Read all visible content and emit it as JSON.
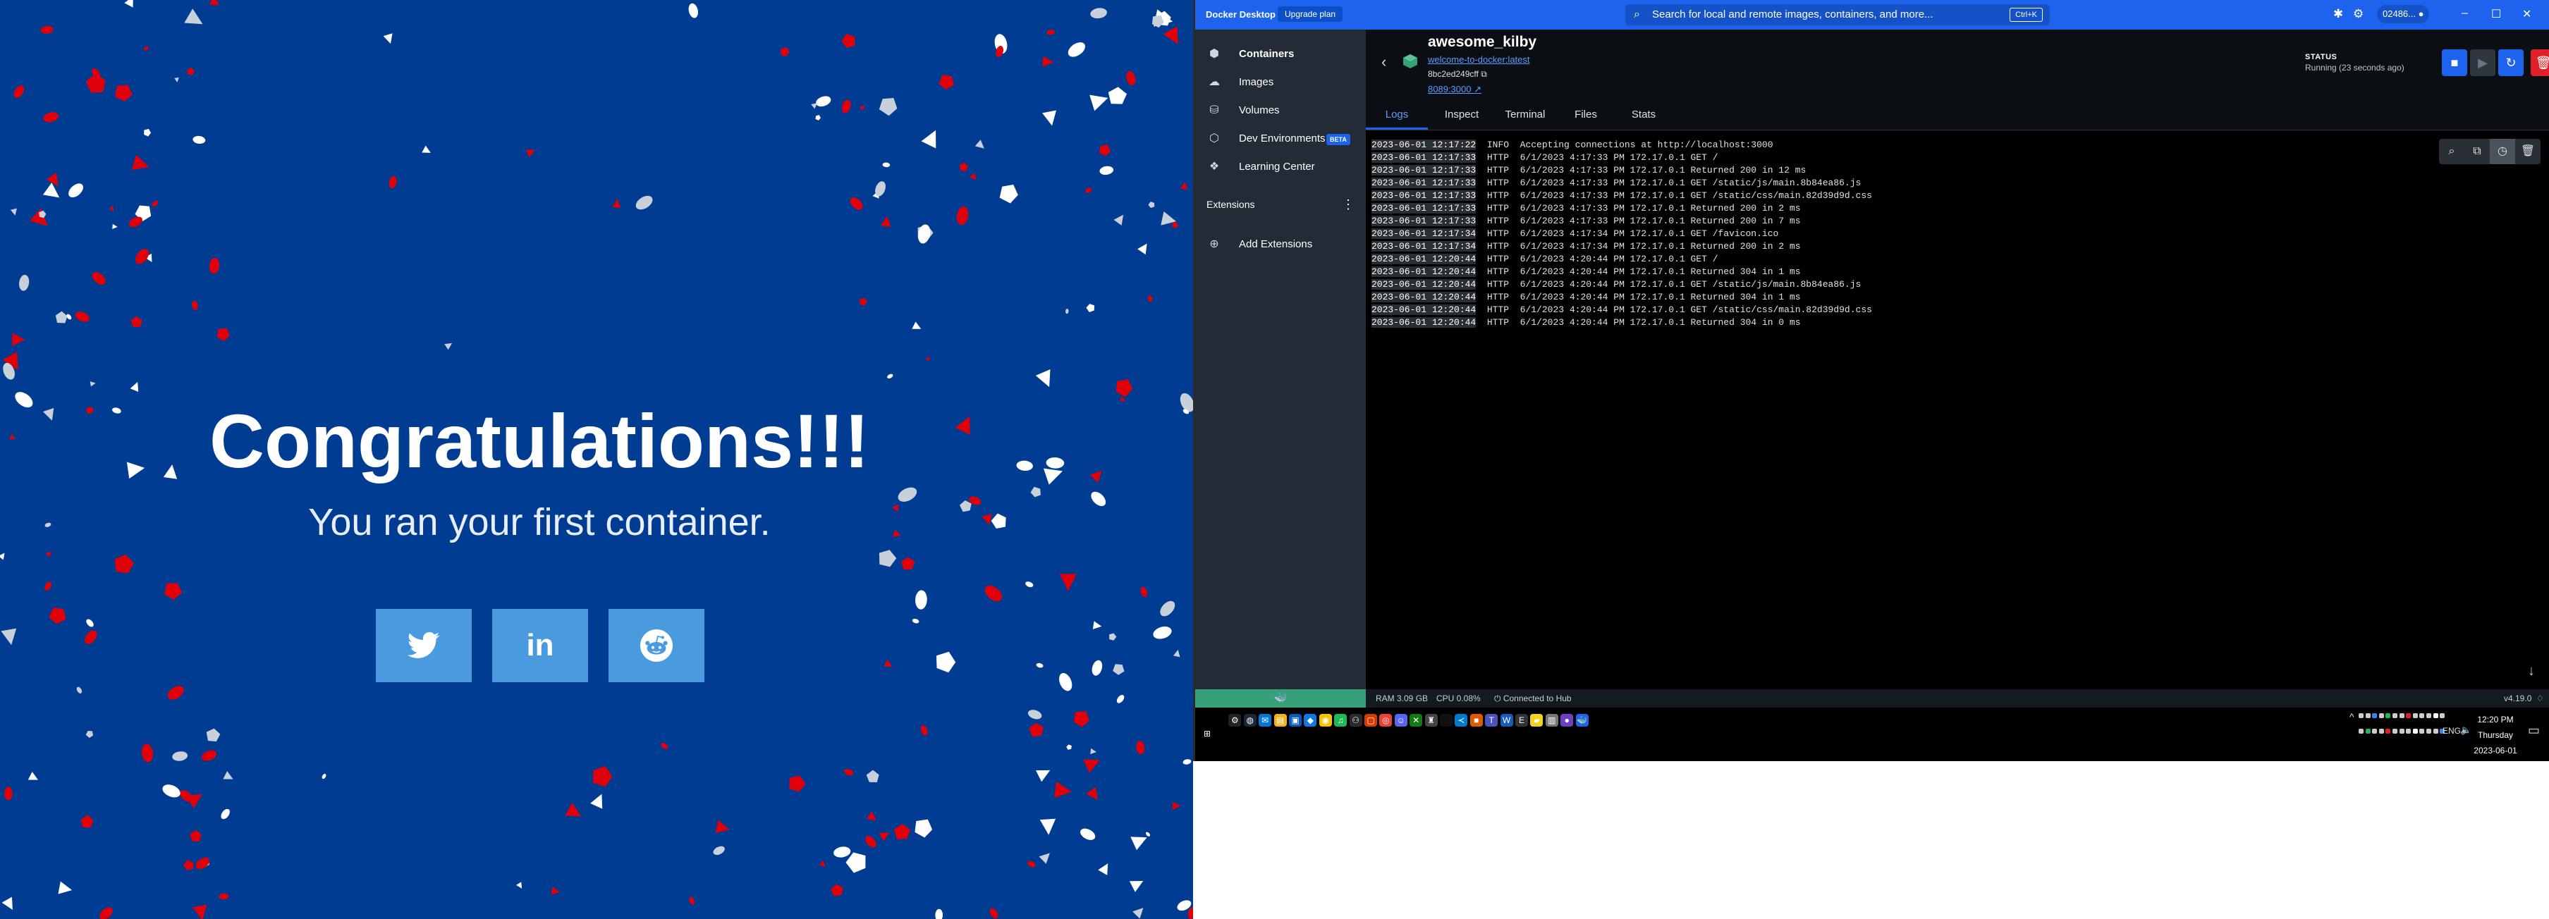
{
  "page": {
    "headline": "Congratulations!!!",
    "subtitle": "You ran your first container.",
    "share_buttons": [
      {
        "network": "twitter",
        "icon": "twitter-icon"
      },
      {
        "network": "linkedin",
        "icon": "linkedin-icon",
        "glyph": "in"
      },
      {
        "network": "reddit",
        "icon": "reddit-icon"
      }
    ],
    "colors": {
      "background": "#013c93",
      "button": "#4a9ae0",
      "confetti_red": "#e0000a",
      "confetti_white": "#ffffff"
    }
  },
  "docker": {
    "titlebar": {
      "app_name": "Docker Desktop",
      "upgrade_label": "Upgrade plan",
      "search_placeholder": "Search for local and remote images, containers, and more...",
      "search_shortcut": "Ctrl+K",
      "user": "02486...",
      "icons": [
        "bug-icon",
        "gear-icon",
        "account-icon",
        "minimize-icon",
        "maximize-icon",
        "close-icon"
      ]
    },
    "sidebar": {
      "items": [
        {
          "label": "Containers",
          "icon": "containers-icon",
          "active": true
        },
        {
          "label": "Images",
          "icon": "images-icon"
        },
        {
          "label": "Volumes",
          "icon": "volumes-icon"
        },
        {
          "label": "Dev Environments",
          "icon": "dev-environments-icon",
          "badge": "BETA"
        },
        {
          "label": "Learning Center",
          "icon": "learning-center-icon"
        }
      ],
      "extensions_label": "Extensions",
      "add_extensions_label": "Add Extensions"
    },
    "container": {
      "name": "awesome_kilby",
      "image": "welcome-to-docker:latest",
      "id": "8bc2ed249cff",
      "port": "8089:3000",
      "status_label": "STATUS",
      "status_value": "Running (23 seconds ago)"
    },
    "tabs": [
      "Logs",
      "Inspect",
      "Terminal",
      "Files",
      "Stats"
    ],
    "active_tab": "Logs",
    "logs": [
      {
        "ts": "2023-06-01 12:17:22",
        "level": "INFO",
        "msg": "Accepting connections at http://localhost:3000"
      },
      {
        "ts": "2023-06-01 12:17:33",
        "level": "HTTP",
        "msg": "6/1/2023 4:17:33 PM 172.17.0.1 GET /"
      },
      {
        "ts": "2023-06-01 12:17:33",
        "level": "HTTP",
        "msg": "6/1/2023 4:17:33 PM 172.17.0.1 Returned 200 in 12 ms"
      },
      {
        "ts": "2023-06-01 12:17:33",
        "level": "HTTP",
        "msg": "6/1/2023 4:17:33 PM 172.17.0.1 GET /static/js/main.8b84ea86.js"
      },
      {
        "ts": "2023-06-01 12:17:33",
        "level": "HTTP",
        "msg": "6/1/2023 4:17:33 PM 172.17.0.1 GET /static/css/main.82d39d9d.css"
      },
      {
        "ts": "2023-06-01 12:17:33",
        "level": "HTTP",
        "msg": "6/1/2023 4:17:33 PM 172.17.0.1 Returned 200 in 2 ms"
      },
      {
        "ts": "2023-06-01 12:17:33",
        "level": "HTTP",
        "msg": "6/1/2023 4:17:33 PM 172.17.0.1 Returned 200 in 7 ms"
      },
      {
        "ts": "2023-06-01 12:17:34",
        "level": "HTTP",
        "msg": "6/1/2023 4:17:34 PM 172.17.0.1 GET /favicon.ico"
      },
      {
        "ts": "2023-06-01 12:17:34",
        "level": "HTTP",
        "msg": "6/1/2023 4:17:34 PM 172.17.0.1 Returned 200 in 2 ms"
      },
      {
        "ts": "2023-06-01 12:20:44",
        "level": "HTTP",
        "msg": "6/1/2023 4:20:44 PM 172.17.0.1 GET /"
      },
      {
        "ts": "2023-06-01 12:20:44",
        "level": "HTTP",
        "msg": "6/1/2023 4:20:44 PM 172.17.0.1 Returned 304 in 1 ms"
      },
      {
        "ts": "2023-06-01 12:20:44",
        "level": "HTTP",
        "msg": "6/1/2023 4:20:44 PM 172.17.0.1 GET /static/js/main.8b84ea86.js"
      },
      {
        "ts": "2023-06-01 12:20:44",
        "level": "HTTP",
        "msg": "6/1/2023 4:20:44 PM 172.17.0.1 Returned 304 in 1 ms"
      },
      {
        "ts": "2023-06-01 12:20:44",
        "level": "HTTP",
        "msg": "6/1/2023 4:20:44 PM 172.17.0.1 GET /static/css/main.82d39d9d.css"
      },
      {
        "ts": "2023-06-01 12:20:44",
        "level": "HTTP",
        "msg": "6/1/2023 4:20:44 PM 172.17.0.1 Returned 304 in 0 ms"
      }
    ],
    "statusbar": {
      "ram": "RAM 3.09 GB",
      "cpu": "CPU 0.08%",
      "hub": "Connected to Hub",
      "version": "v4.19.0"
    },
    "colors": {
      "accent": "#1d63ed",
      "sidebar": "#222b36",
      "engine_ok": "#36a079",
      "delete": "#e0212b"
    }
  },
  "taskbar": {
    "language": "ENG",
    "time": "12:20 PM",
    "day": "Thursday",
    "date": "2023-06-01",
    "apps": [
      "windows-start-icon",
      "settings-icon",
      "steam-icon",
      "mail-icon",
      "file-explorer-icon",
      "store-icon",
      "app-icon",
      "norton-icon",
      "spotify-icon",
      "game-icon",
      "office-icon",
      "chrome-icon",
      "discord-icon",
      "xbox-icon",
      "game-bar-icon",
      "blank-icon",
      "vscode-icon",
      "app-orange-icon",
      "teams-icon",
      "word-icon",
      "epic-games-icon",
      "sticky-notes-icon",
      "app-grey-icon",
      "obs-icon",
      "docker-icon"
    ]
  }
}
